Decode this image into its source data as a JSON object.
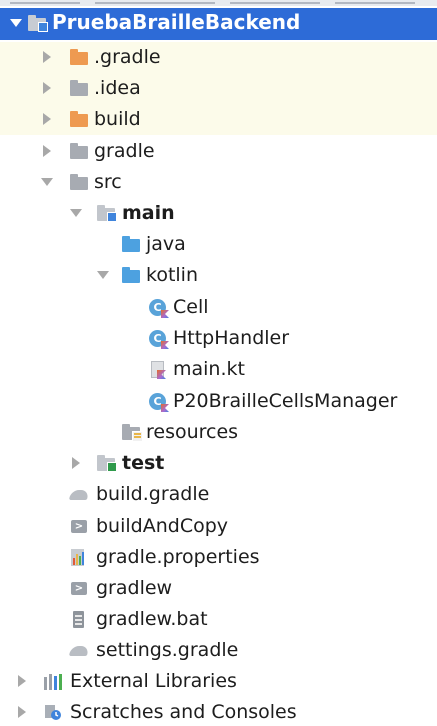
{
  "project": {
    "root": {
      "label": "PruebaBrailleBackend",
      "expanded": true
    },
    "nodes": [
      {
        "label": ".gradle",
        "icon": "folder-orange-icon",
        "expanded": false
      },
      {
        "label": ".idea",
        "icon": "folder-gray-icon",
        "expanded": false
      },
      {
        "label": "build",
        "icon": "folder-orange-icon",
        "expanded": false
      },
      {
        "label": "gradle",
        "icon": "folder-gray-icon",
        "expanded": false
      },
      {
        "label": "src",
        "icon": "folder-gray-icon",
        "expanded": true
      },
      {
        "label": "main",
        "icon": "module-folder-icon",
        "expanded": true
      },
      {
        "label": "java",
        "icon": "source-folder-icon"
      },
      {
        "label": "kotlin",
        "icon": "source-folder-icon",
        "expanded": true
      },
      {
        "label": "Cell",
        "icon": "kotlin-class-icon"
      },
      {
        "label": "HttpHandler",
        "icon": "kotlin-class-icon"
      },
      {
        "label": "main.kt",
        "icon": "kotlin-file-icon"
      },
      {
        "label": "P20BrailleCellsManager",
        "icon": "kotlin-class-icon"
      },
      {
        "label": "resources",
        "icon": "resources-folder-icon"
      },
      {
        "label": "test",
        "icon": "module-folder-icon",
        "expanded": false
      },
      {
        "label": "build.gradle",
        "icon": "gradle-icon"
      },
      {
        "label": "buildAndCopy",
        "icon": "shell-script-icon"
      },
      {
        "label": "gradle.properties",
        "icon": "properties-icon"
      },
      {
        "label": "gradlew",
        "icon": "shell-script-icon"
      },
      {
        "label": "gradlew.bat",
        "icon": "batch-file-icon"
      },
      {
        "label": "settings.gradle",
        "icon": "gradle-icon"
      },
      {
        "label": "External Libraries",
        "icon": "libraries-icon",
        "expanded": false
      },
      {
        "label": "Scratches and Consoles",
        "icon": "scratches-icon",
        "expanded": false
      }
    ]
  },
  "colors": {
    "selection": "#2d6bd7",
    "excluded_highlight": "#fcfbea",
    "folder_orange": "#ee9a51",
    "folder_blue": "#4da1e0"
  }
}
